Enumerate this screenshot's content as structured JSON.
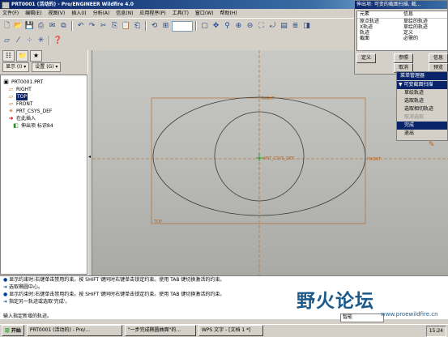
{
  "window": {
    "title": "PRT0001 (活动的) - Pro/ENGINEER Wildfire 4.0",
    "min": "_",
    "max": "□",
    "close": "×"
  },
  "menu": [
    "文件(F)",
    "编辑(E)",
    "视图(V)",
    "插入(I)",
    "分析(A)",
    "信息(N)",
    "应用程序(P)",
    "工具(T)",
    "窗口(W)",
    "帮助(H)"
  ],
  "left_panel": {
    "show_label": "显示 (I) ▾",
    "settings_label": "设置 (G) ▾",
    "tree": [
      {
        "label": "PRT0001.PRT",
        "icon": "part-icon",
        "glyph": "▣",
        "selected": false
      },
      {
        "label": "RIGHT",
        "icon": "datum-plane-icon",
        "glyph": "▱",
        "selected": false
      },
      {
        "label": "TOP",
        "icon": "datum-plane-icon",
        "glyph": "▱",
        "selected": true
      },
      {
        "label": "FRONT",
        "icon": "datum-plane-icon",
        "glyph": "▱",
        "selected": false
      },
      {
        "label": "PRT_CSYS_DEF",
        "icon": "csys-icon",
        "glyph": "✳",
        "selected": false
      },
      {
        "label": "在此插入",
        "icon": "insert-arrow-icon",
        "glyph": "➜",
        "selected": false
      },
      {
        "label": "伸出项 标识84",
        "icon": "protrusion-icon",
        "glyph": "◧",
        "selected": false
      }
    ]
  },
  "graphics": {
    "labels": {
      "right": "RIGHT",
      "front": "FRONT",
      "top": "TOP",
      "csys": "PRT_CSYS_DEF"
    },
    "colors": {
      "datum": "#b5651d",
      "sketch": "#3a3a3a",
      "csys": "#1a9a1a"
    }
  },
  "feature_dialog": {
    "title": "伸出项: 可变的截面扫描, 截...",
    "col1": "元素",
    "col2": "信息",
    "rows": [
      {
        "element": "原点轨迹",
        "info": "草绘的轨迹"
      },
      {
        "element": "X轨迹",
        "info": "草绘的轨迹"
      },
      {
        "element": "轨迹",
        "info": "定义"
      },
      {
        "element": "截面",
        "info": "必需的"
      }
    ],
    "buttons": {
      "define": "定义",
      "ref": "参照",
      "info": "信息",
      "cancel": "取消",
      "preview": "预览"
    }
  },
  "menu_manager": {
    "title": "菜单管理器",
    "submenu": "▼ 可变截面扫描",
    "items": [
      {
        "label": "草绘轨迹",
        "state": "normal"
      },
      {
        "label": "选取轨迹",
        "state": "normal"
      },
      {
        "label": "选取相切轨迹",
        "state": "normal"
      },
      {
        "label": "取消选取",
        "state": "disabled"
      },
      {
        "label": "完成",
        "state": "selected"
      },
      {
        "label": "退出",
        "state": "normal"
      }
    ]
  },
  "messages": [
    "显示约束时:右键单击禁用约束。按 SHIFT 键同时右键单击锁定约束。使用 TAB 键切换激活的约束。",
    "选取椭圆中心。",
    "显示约束时:右键单击禁用约束。按 SHIFT 键同时右键单击锁定约束。使用 TAB 键切换激活的约束。",
    "指定另一轨迹或选取'完成'。",
    "",
    "输入指定新增的轨迹。"
  ],
  "status": {
    "filter": "智能"
  },
  "taskbar": {
    "start": "开始",
    "tasks": [
      "PRT0001 (活动的) - Pro/...",
      "\"一步完成椭圆曲面\"的...",
      "WPS 文字 - [文档 1 *]"
    ],
    "time": "15:24"
  },
  "watermark": {
    "text": "野火论坛",
    "url": "www.proewildfire.cn"
  }
}
